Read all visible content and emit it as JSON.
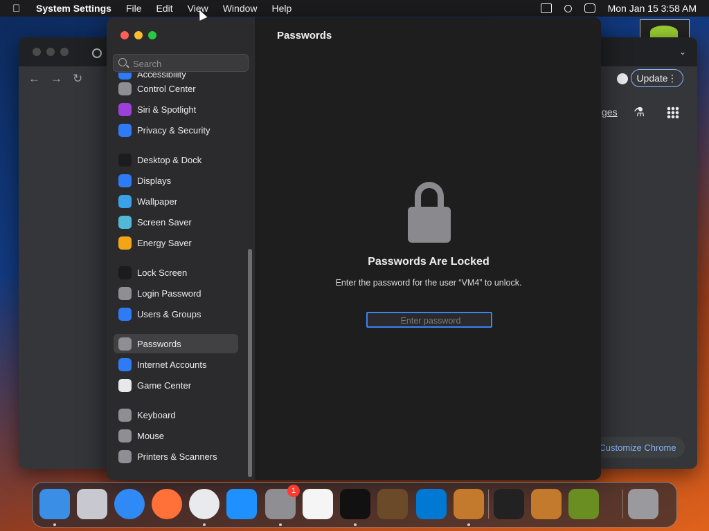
{
  "menubar": {
    "app": "System Settings",
    "items": [
      "File",
      "Edit",
      "View",
      "Window",
      "Help"
    ],
    "clock": "Mon Jan 15  3:58 AM"
  },
  "chrome": {
    "update_label": "Update",
    "pages_label": "ges",
    "customize_label": "Customize Chrome"
  },
  "settings": {
    "search_placeholder": "Search",
    "page_title": "Passwords",
    "sidebar": [
      {
        "label": "Accessibility",
        "icon": "accessibility-icon",
        "color": "#2f7bf6"
      },
      {
        "label": "Control Center",
        "icon": "control-center-icon",
        "color": "#8e8e93"
      },
      {
        "label": "Siri & Spotlight",
        "icon": "siri-icon",
        "color": "#9b40d8"
      },
      {
        "label": "Privacy & Security",
        "icon": "hand-icon",
        "color": "#2f7bf6"
      },
      {
        "label": "Desktop & Dock",
        "icon": "dock-icon",
        "color": "#1c1c1e"
      },
      {
        "label": "Displays",
        "icon": "sun-icon",
        "color": "#2f7bf6"
      },
      {
        "label": "Wallpaper",
        "icon": "wallpaper-icon",
        "color": "#3aa0e8"
      },
      {
        "label": "Screen Saver",
        "icon": "screen-saver-icon",
        "color": "#52b8d8"
      },
      {
        "label": "Energy Saver",
        "icon": "bulb-icon",
        "color": "#f2a516"
      },
      {
        "label": "Lock Screen",
        "icon": "lock-icon",
        "color": "#1c1c1e"
      },
      {
        "label": "Login Password",
        "icon": "lock-icon",
        "color": "#8e8e93"
      },
      {
        "label": "Users & Groups",
        "icon": "users-icon",
        "color": "#2f7bf6"
      },
      {
        "label": "Passwords",
        "icon": "key-icon",
        "color": "#8e8e93"
      },
      {
        "label": "Internet Accounts",
        "icon": "at-icon",
        "color": "#2f7bf6"
      },
      {
        "label": "Game Center",
        "icon": "game-center-icon",
        "color": "#e8e8e8"
      },
      {
        "label": "Keyboard",
        "icon": "keyboard-icon",
        "color": "#8e8e93"
      },
      {
        "label": "Mouse",
        "icon": "mouse-icon",
        "color": "#8e8e93"
      },
      {
        "label": "Printers & Scanners",
        "icon": "printer-icon",
        "color": "#8e8e93"
      }
    ],
    "selected": "Passwords",
    "locked_title": "Passwords Are Locked",
    "locked_desc": "Enter the password for the user “VM4” to unlock.",
    "password_placeholder": "Enter password"
  },
  "dock": {
    "apps": [
      {
        "name": "finder",
        "color": "#3a8ee6"
      },
      {
        "name": "launchpad",
        "color": "#c8c8d0"
      },
      {
        "name": "safari",
        "color": "#2f8af5"
      },
      {
        "name": "firefox",
        "color": "#ff7139"
      },
      {
        "name": "chrome",
        "color": "#e8eaed"
      },
      {
        "name": "app-store",
        "color": "#1e90ff"
      },
      {
        "name": "system-settings",
        "color": "#8e8e93"
      },
      {
        "name": "textedit",
        "color": "#f5f5f5"
      },
      {
        "name": "terminal",
        "color": "#111111"
      },
      {
        "name": "garageband",
        "color": "#6b4a2a"
      },
      {
        "name": "vscode",
        "color": "#0078d4"
      },
      {
        "name": "acorn",
        "color": "#c47a2c"
      },
      {
        "name": "pixelmator",
        "color": "#222222"
      },
      {
        "name": "acorn-2",
        "color": "#c47a2c"
      },
      {
        "name": "script-editor",
        "color": "#6b8e23"
      },
      {
        "name": "trash",
        "color": "#9a9a9e"
      }
    ],
    "settings_badge": "1"
  }
}
